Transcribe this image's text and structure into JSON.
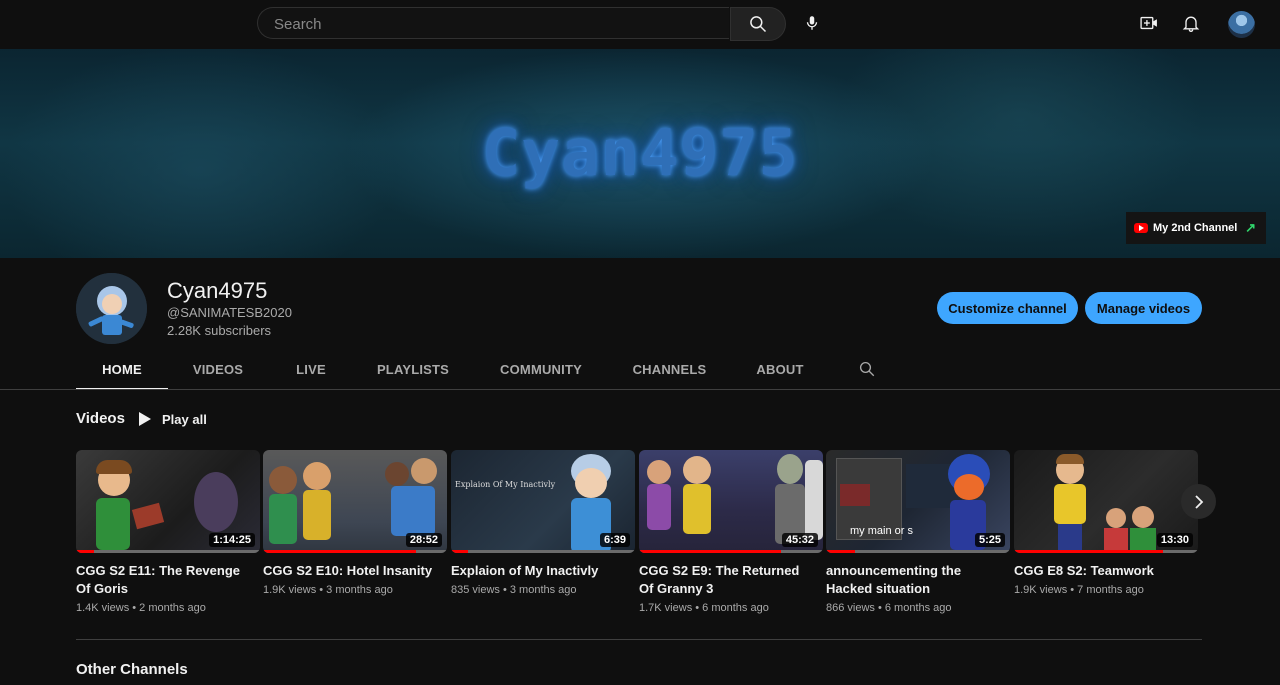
{
  "topbar": {
    "search_placeholder": "Search",
    "icons": [
      "search-icon",
      "mic-icon",
      "create-video-icon",
      "bell-icon",
      "account-avatar"
    ]
  },
  "banner": {
    "title": "Cyan4975",
    "link_label": "My 2nd Channel"
  },
  "channel": {
    "name": "Cyan4975",
    "handle": "@SANIMATESB2020",
    "subscribers": "2.28K subscribers",
    "customize_label": "Customize channel",
    "manage_label": "Manage videos"
  },
  "tabs": [
    {
      "label": "HOME",
      "active": true
    },
    {
      "label": "VIDEOS",
      "active": false
    },
    {
      "label": "LIVE",
      "active": false
    },
    {
      "label": "PLAYLISTS",
      "active": false
    },
    {
      "label": "COMMUNITY",
      "active": false
    },
    {
      "label": "CHANNELS",
      "active": false
    },
    {
      "label": "ABOUT",
      "active": false
    }
  ],
  "videos_section": {
    "title": "Videos",
    "play_all_label": "Play all",
    "videos": [
      {
        "title": "CGG S2 E11: The Revenge Of Goris",
        "meta": "1.4K views • 2 months ago",
        "duration": "1:14:25",
        "progress": 0.1
      },
      {
        "title": "CGG S2 E10: Hotel Insanity",
        "meta": "1.9K views • 3 months ago",
        "duration": "28:52",
        "progress": 0.83
      },
      {
        "title": "Explaion of My Inactivly",
        "meta": "835 views • 3 months ago",
        "duration": "6:39",
        "progress": 0.09,
        "thumb_text": "Explaion Of My Inactivly"
      },
      {
        "title": "CGG S2 E9: The Returned Of Granny 3",
        "meta": "1.7K views • 6 months ago",
        "duration": "45:32",
        "progress": 0.77
      },
      {
        "title": "announcementing the Hacked situation",
        "meta": "866 views • 6 months ago",
        "duration": "5:25",
        "progress": 0.16,
        "thumb_text": "my main or s"
      },
      {
        "title": "CGG E8 S2: Teamwork",
        "meta": "1.9K views • 7 months ago",
        "duration": "13:30",
        "progress": 0.81
      }
    ]
  },
  "other_section": {
    "title": "Other Channels"
  },
  "colors": {
    "background": "#0f0f0f",
    "accent_blue": "#3ea6ff",
    "progress_red": "#ff0000",
    "text_secondary": "#aaaaaa"
  }
}
